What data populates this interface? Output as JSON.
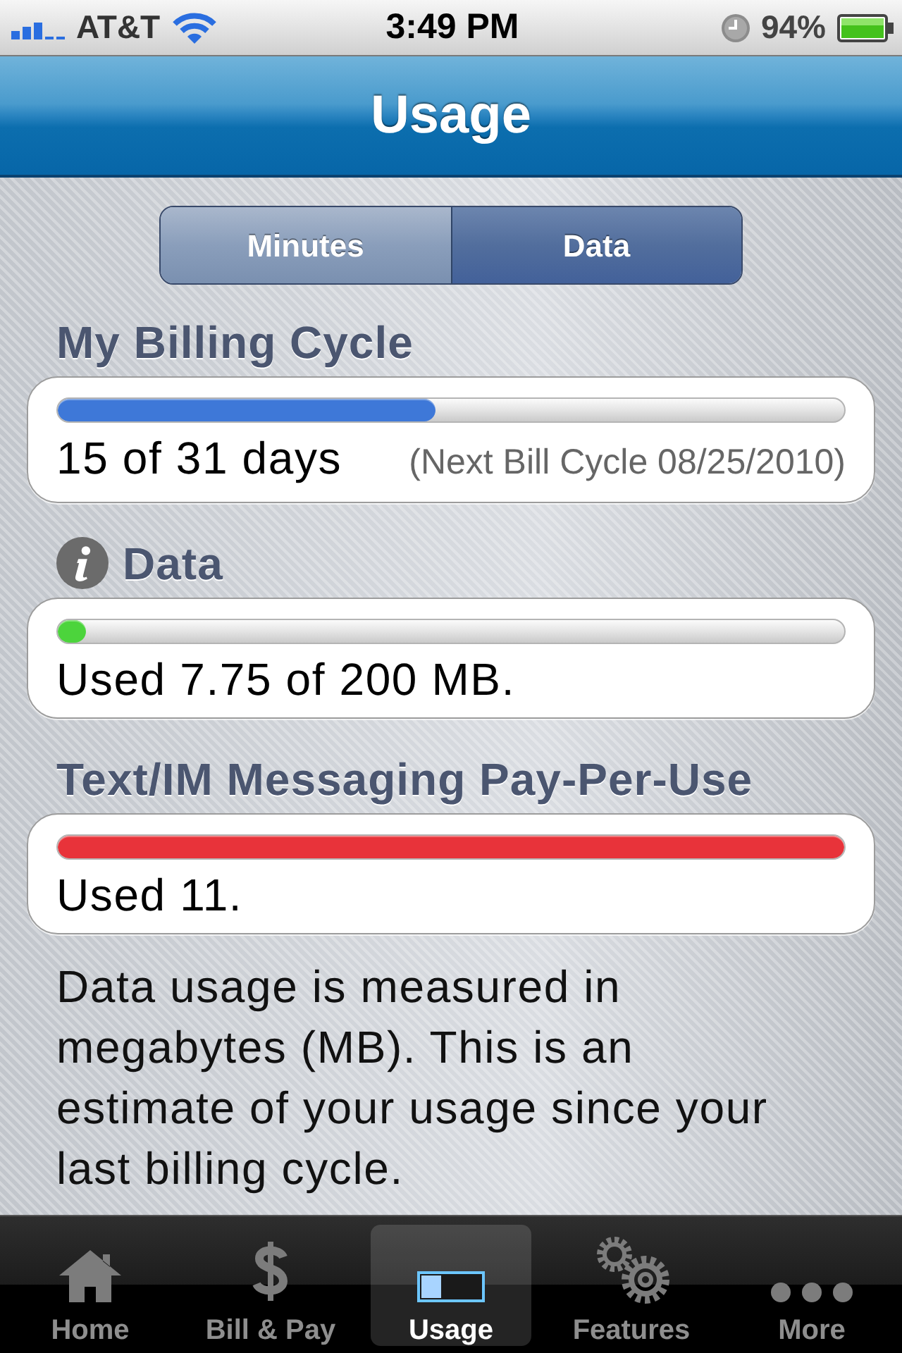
{
  "status_bar": {
    "carrier": "AT&T",
    "time": "3:49 PM",
    "battery": "94%"
  },
  "nav_bar": {
    "title": "Usage"
  },
  "segments": [
    {
      "label": "Minutes",
      "selected": false
    },
    {
      "label": "Data",
      "selected": true
    }
  ],
  "sections": [
    {
      "title": "My Billing Cycle",
      "info_icon": false,
      "level": 0.48,
      "color": "#3e78d8",
      "summary": "15 of 31 days",
      "note": "(Next Bill Cycle 08/25/2010)"
    },
    {
      "title": "Data",
      "info_icon": true,
      "level": 0.036,
      "color": "#4cd43c",
      "summary": "Used 7.75 of 200 MB."
    },
    {
      "title": "Text/IM Messaging Pay-Per-Use",
      "info_icon": false,
      "level": 1,
      "color": "#e8333a",
      "summary": "Used 11."
    }
  ],
  "description": "Data usage is measured in megabytes (MB). This is an estimate of your usage since your last billing cycle.",
  "tab_bar": [
    {
      "label": "Home",
      "kind": "home",
      "selected": false
    },
    {
      "label": "Bill & Pay",
      "kind": "dollar",
      "selected": false
    },
    {
      "label": "Usage",
      "kind": "meter",
      "selected": true
    },
    {
      "label": "Features",
      "kind": "gears",
      "selected": false
    },
    {
      "label": "More",
      "kind": "more",
      "selected": false
    }
  ]
}
